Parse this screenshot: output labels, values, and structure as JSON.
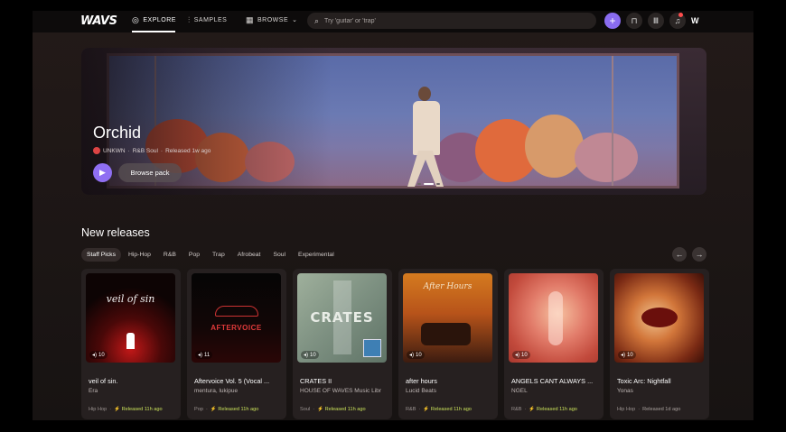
{
  "nav": {
    "logo": "WAVS",
    "items": [
      {
        "label": "EXPLORE",
        "icon": "compass-icon"
      },
      {
        "label": "SAMPLES",
        "icon": "waveform-icon"
      },
      {
        "label": "BROWSE",
        "icon": "grid-icon"
      }
    ],
    "search_placeholder": "Try 'guitar' or 'trap'",
    "brand_mark": "W"
  },
  "hero": {
    "title": "Orchid",
    "artist": "UNKWN",
    "genre": "R&B Soul",
    "released": "Released 1w ago",
    "browse_label": "Browse pack"
  },
  "releases": {
    "title": "New releases",
    "chips": [
      "Staff Picks",
      "Hip-Hop",
      "R&B",
      "Pop",
      "Trap",
      "Afrobeat",
      "Soul",
      "Experimental"
    ],
    "cards": [
      {
        "title": "veil of sin.",
        "artist": "Era",
        "genre": "Hip Hop",
        "released": "Released 11h ago",
        "plays": "10",
        "art_text": "veil of sin"
      },
      {
        "title": "Aftervoice Vol. 5 (Vocal ...",
        "artist": "mentura, lukipue",
        "genre": "Pop",
        "released": "Released 11h ago",
        "plays": "11",
        "art_text": "AFTERVOICE"
      },
      {
        "title": "CRATES II",
        "artist": "HOUSE OF WAVES Music Libr",
        "genre": "Soul",
        "released": "Released 11h ago",
        "plays": "10",
        "art_text": "CRATES"
      },
      {
        "title": "after hours",
        "artist": "Lucid Beats",
        "genre": "R&B",
        "released": "Released 11h ago",
        "plays": "10",
        "art_text": "After Hours"
      },
      {
        "title": "ANGELS CANT ALWAYS ...",
        "artist": "NGEL",
        "genre": "R&B",
        "released": "Released 11h ago",
        "plays": "10",
        "art_text": ""
      },
      {
        "title": "Toxic Arc: Nightfall",
        "artist": "Yonas",
        "genre": "Hip Hop",
        "released": "Released 1d ago",
        "plays": "10",
        "art_text": ""
      }
    ]
  },
  "colors": {
    "accent": "#8a6cf0",
    "released": "#c8e05a"
  }
}
